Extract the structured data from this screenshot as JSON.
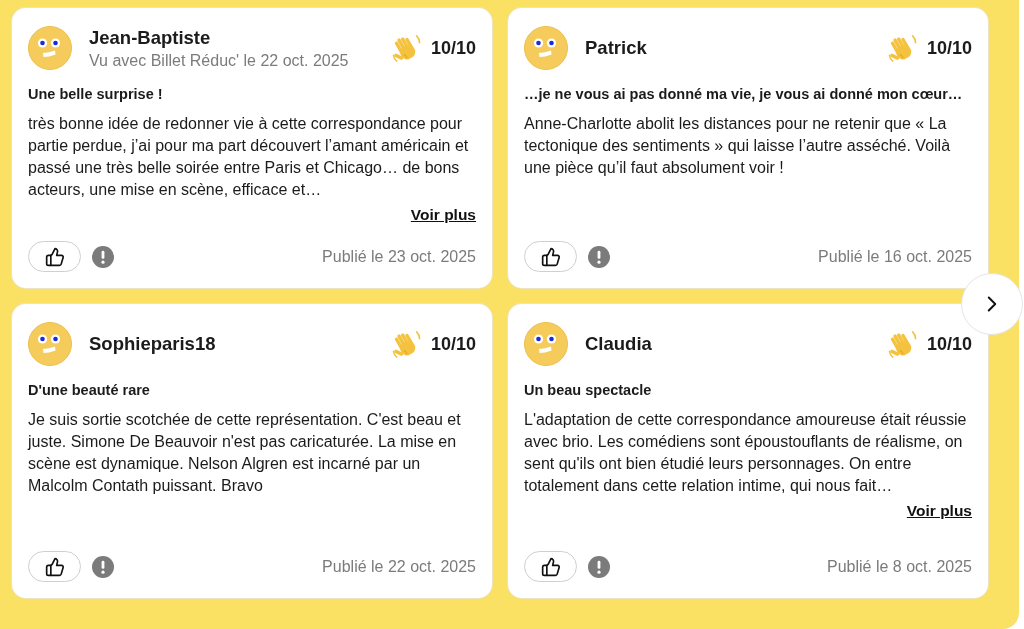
{
  "reviews": [
    {
      "author": "Jean-Baptiste",
      "visit": "Vu avec Billet Réduc' le 22 oct. 2025",
      "score": "10/10",
      "title": "Une belle surprise !",
      "body": "très bonne idée de redonner vie à cette correspondance pour partie perdue, j’ai pour ma part découvert l’amant américain et passé une très belle soirée entre Paris et Chicago… de bons acteurs, une mise en scène, efficace et…",
      "more": "Voir plus",
      "published": "Publié le 23 oct. 2025"
    },
    {
      "author": "Patrick",
      "score": "10/10",
      "title": "…je ne vous ai pas donné ma vie, je vous ai donné mon cœur…",
      "body": "Anne-Charlotte abolit les distances pour ne retenir que « La tectonique des sentiments » qui laisse l’autre asséché. Voilà une pièce qu’il faut absolument voir !",
      "published": "Publié le 16 oct. 2025"
    },
    {
      "author": "Sophieparis18",
      "score": "10/10",
      "title": "D'une beauté rare",
      "body": "Je suis sortie scotchée de cette représentation. C'est beau et juste. Simone De Beauvoir n'est pas caricaturée. La mise en scène est dynamique. Nelson Algren est incarné par un Malcolm Contath puissant. Bravo",
      "published": "Publié le 22 oct. 2025"
    },
    {
      "author": "Claudia",
      "score": "10/10",
      "title": "Un beau spectacle",
      "body": "L'adaptation de cette correspondance amoureuse était réussie avec brio. Les comédiens sont époustouflants de réalisme, on sent qu'ils ont bien étudié leurs personnages. On entre totalement dans cette relation intime, qui nous fait…",
      "more": "Voir plus",
      "published": "Publié le 8 oct. 2025"
    }
  ]
}
